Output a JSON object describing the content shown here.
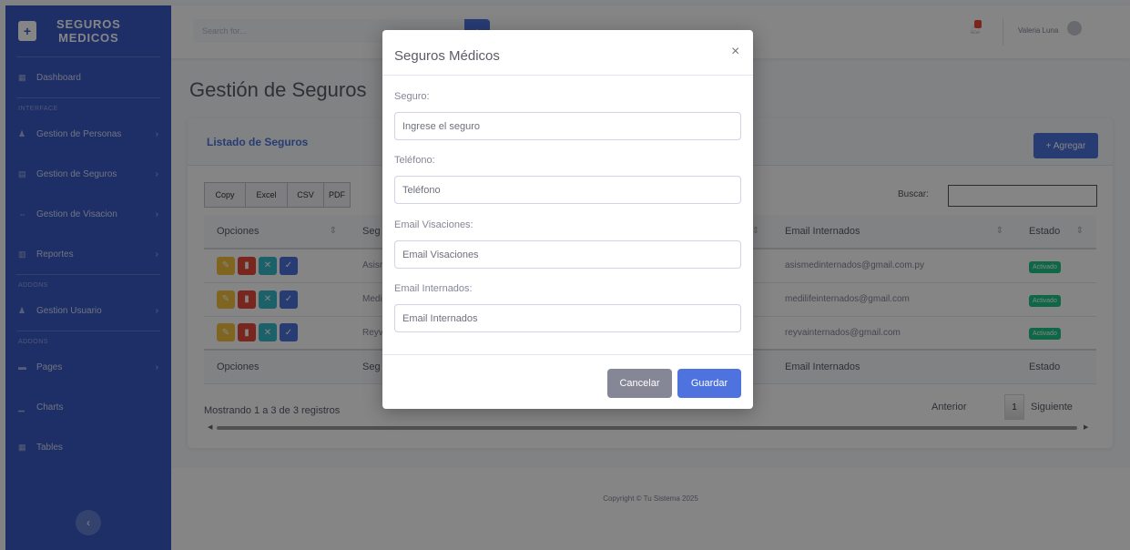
{
  "sidebar": {
    "brand_line1": "SEGUROS",
    "brand_line2": "MEDICOS",
    "dashboard": "Dashboard",
    "heading_interface": "INTERFACE",
    "items": [
      {
        "label": "Gestion de Personas"
      },
      {
        "label": "Gestion de Seguros"
      },
      {
        "label": "Gestion de Visacion"
      },
      {
        "label": "Reportes"
      }
    ],
    "heading_addons1": "ADDONS",
    "usuario": "Gestion Usuario",
    "heading_addons2": "ADDONS",
    "pages": "Pages",
    "charts": "Charts",
    "tables": "Tables"
  },
  "topbar": {
    "search_placeholder": "Search for...",
    "user_name": "Valeria Luna"
  },
  "main": {
    "page_title": "Gestión de Seguros",
    "card_title": "Listado de Seguros",
    "add_label": "+ Agregar",
    "export_buttons": [
      "Copy",
      "Excel",
      "CSV",
      "PDF"
    ],
    "search_label": "Buscar:",
    "columns": [
      "Opciones",
      "Seg",
      "Email Internados",
      "Estado"
    ],
    "rows": [
      {
        "seguro": "Asisr",
        "email_internados": "asismedinternados@gmail.com.py",
        "estado": "Activado"
      },
      {
        "seguro": "Medi",
        "email_internados": "medilifeinternados@gmail.com",
        "estado": "Activado"
      },
      {
        "seguro": "Reyv",
        "email_internados": "reyvainternados@gmail.com",
        "estado": "Activado"
      }
    ],
    "info": "Mostrando 1 a 3 de 3 registros",
    "prev": "Anterior",
    "page": "1",
    "next": "Siguiente"
  },
  "footer": {
    "copyright": "Copyright © Tu Sistema 2025"
  },
  "modal": {
    "title": "Seguros Médicos",
    "seguro_label": "Seguro:",
    "seguro_placeholder": "Ingrese el seguro",
    "telefono_label": "Teléfono:",
    "telefono_placeholder": "Teléfono",
    "email_vis_label": "Email Visaciones:",
    "email_vis_placeholder": "Email Visaciones",
    "email_int_label": "Email Internados:",
    "email_int_placeholder": "Email Internados",
    "cancel": "Cancelar",
    "save": "Guardar"
  },
  "colors": {
    "primary": "#4e73df",
    "sidebar": "#3a5bc7",
    "success": "#1cc88a",
    "danger": "#e74a3b",
    "warning": "#f6c23e",
    "info": "#36b9cc",
    "secondary": "#858796"
  }
}
